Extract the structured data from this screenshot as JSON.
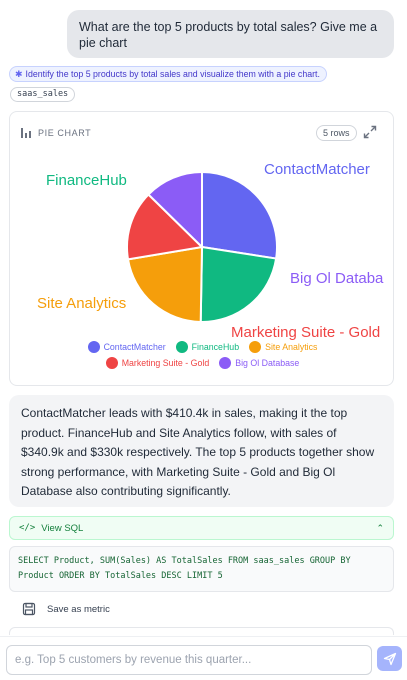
{
  "user_message": "What are the top 5 products by total sales? Give me a pie chart",
  "intent": {
    "icon": "sparkle-icon",
    "text": "Identify the top 5 products by total sales and visualize them with a pie chart."
  },
  "table_chip": "saas_sales",
  "chart_card": {
    "header": "PIE CHART",
    "rows_badge": "5 rows"
  },
  "chart_data": {
    "type": "pie",
    "categories": [
      "ContactMatcher",
      "FinanceHub",
      "Site Analytics",
      "Marketing Suite - Gold",
      "Big Ol Database"
    ],
    "values": [
      410.4,
      340.9,
      330.0,
      223.8,
      189.2
    ],
    "colors": [
      "#6366f1",
      "#10b981",
      "#f59e0b",
      "#ef4444",
      "#8b5cf6"
    ],
    "outer_labels": [
      "ContactMatcher",
      "FinanceHub",
      "Site Analytics",
      "Marketing Suite - Gold",
      "Big Ol Databa"
    ]
  },
  "answer": "ContactMatcher leads with $410.4k in sales, making it the top product. FinanceHub and Site Analytics follow, with sales of $340.9k and $330k respectively. The top 5 products together show strong performance, with Marketing Suite - Gold and Big Ol Database also contributing significantly.",
  "sql": {
    "toggle_label": "View SQL",
    "query": "SELECT Product, SUM(Sales) AS TotalSales FROM saas_sales GROUP BY Product ORDER BY TotalSales DESC LIMIT 5"
  },
  "save_metric_label": "Save as metric",
  "input": {
    "placeholder": "e.g. Top 5 customers by revenue this quarter..."
  }
}
